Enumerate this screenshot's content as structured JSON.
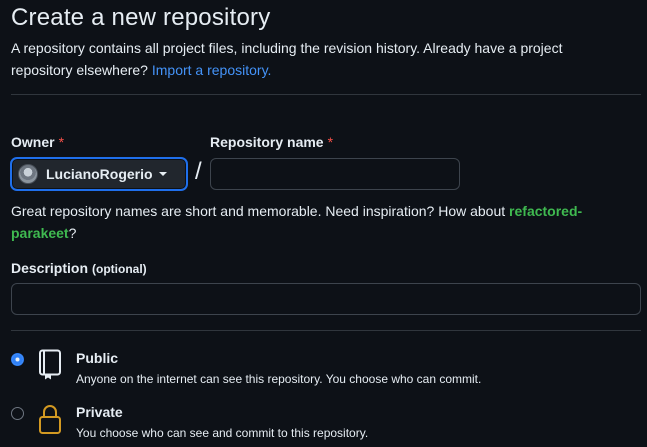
{
  "header": {
    "title": "Create a new repository",
    "subtitle_text": "A repository contains all project files, including the revision history. Already have a project repository elsewhere?",
    "import_link": "Import a repository."
  },
  "owner": {
    "label": "Owner",
    "required_mark": "*",
    "selected": "LucianoRogerio"
  },
  "repo_name": {
    "label": "Repository name",
    "required_mark": "*",
    "value": "",
    "separator": "/"
  },
  "hint": {
    "text": "Great repository names are short and memorable. Need inspiration? How about",
    "suggestion": "refactored-parakeet",
    "end": "?"
  },
  "description": {
    "label": "Description",
    "optional": "(optional)",
    "value": ""
  },
  "visibility": {
    "public": {
      "title": "Public",
      "desc": "Anyone on the internet can see this repository. You choose who can commit.",
      "selected": true
    },
    "private": {
      "title": "Private",
      "desc": "You choose who can see and commit to this repository.",
      "selected": false
    }
  },
  "colors": {
    "background": "#0d1117",
    "accent": "#2f81f7",
    "link": "#4493f8",
    "suggestion": "#3fb950",
    "required": "#f85149",
    "private_icon": "#d29922"
  }
}
